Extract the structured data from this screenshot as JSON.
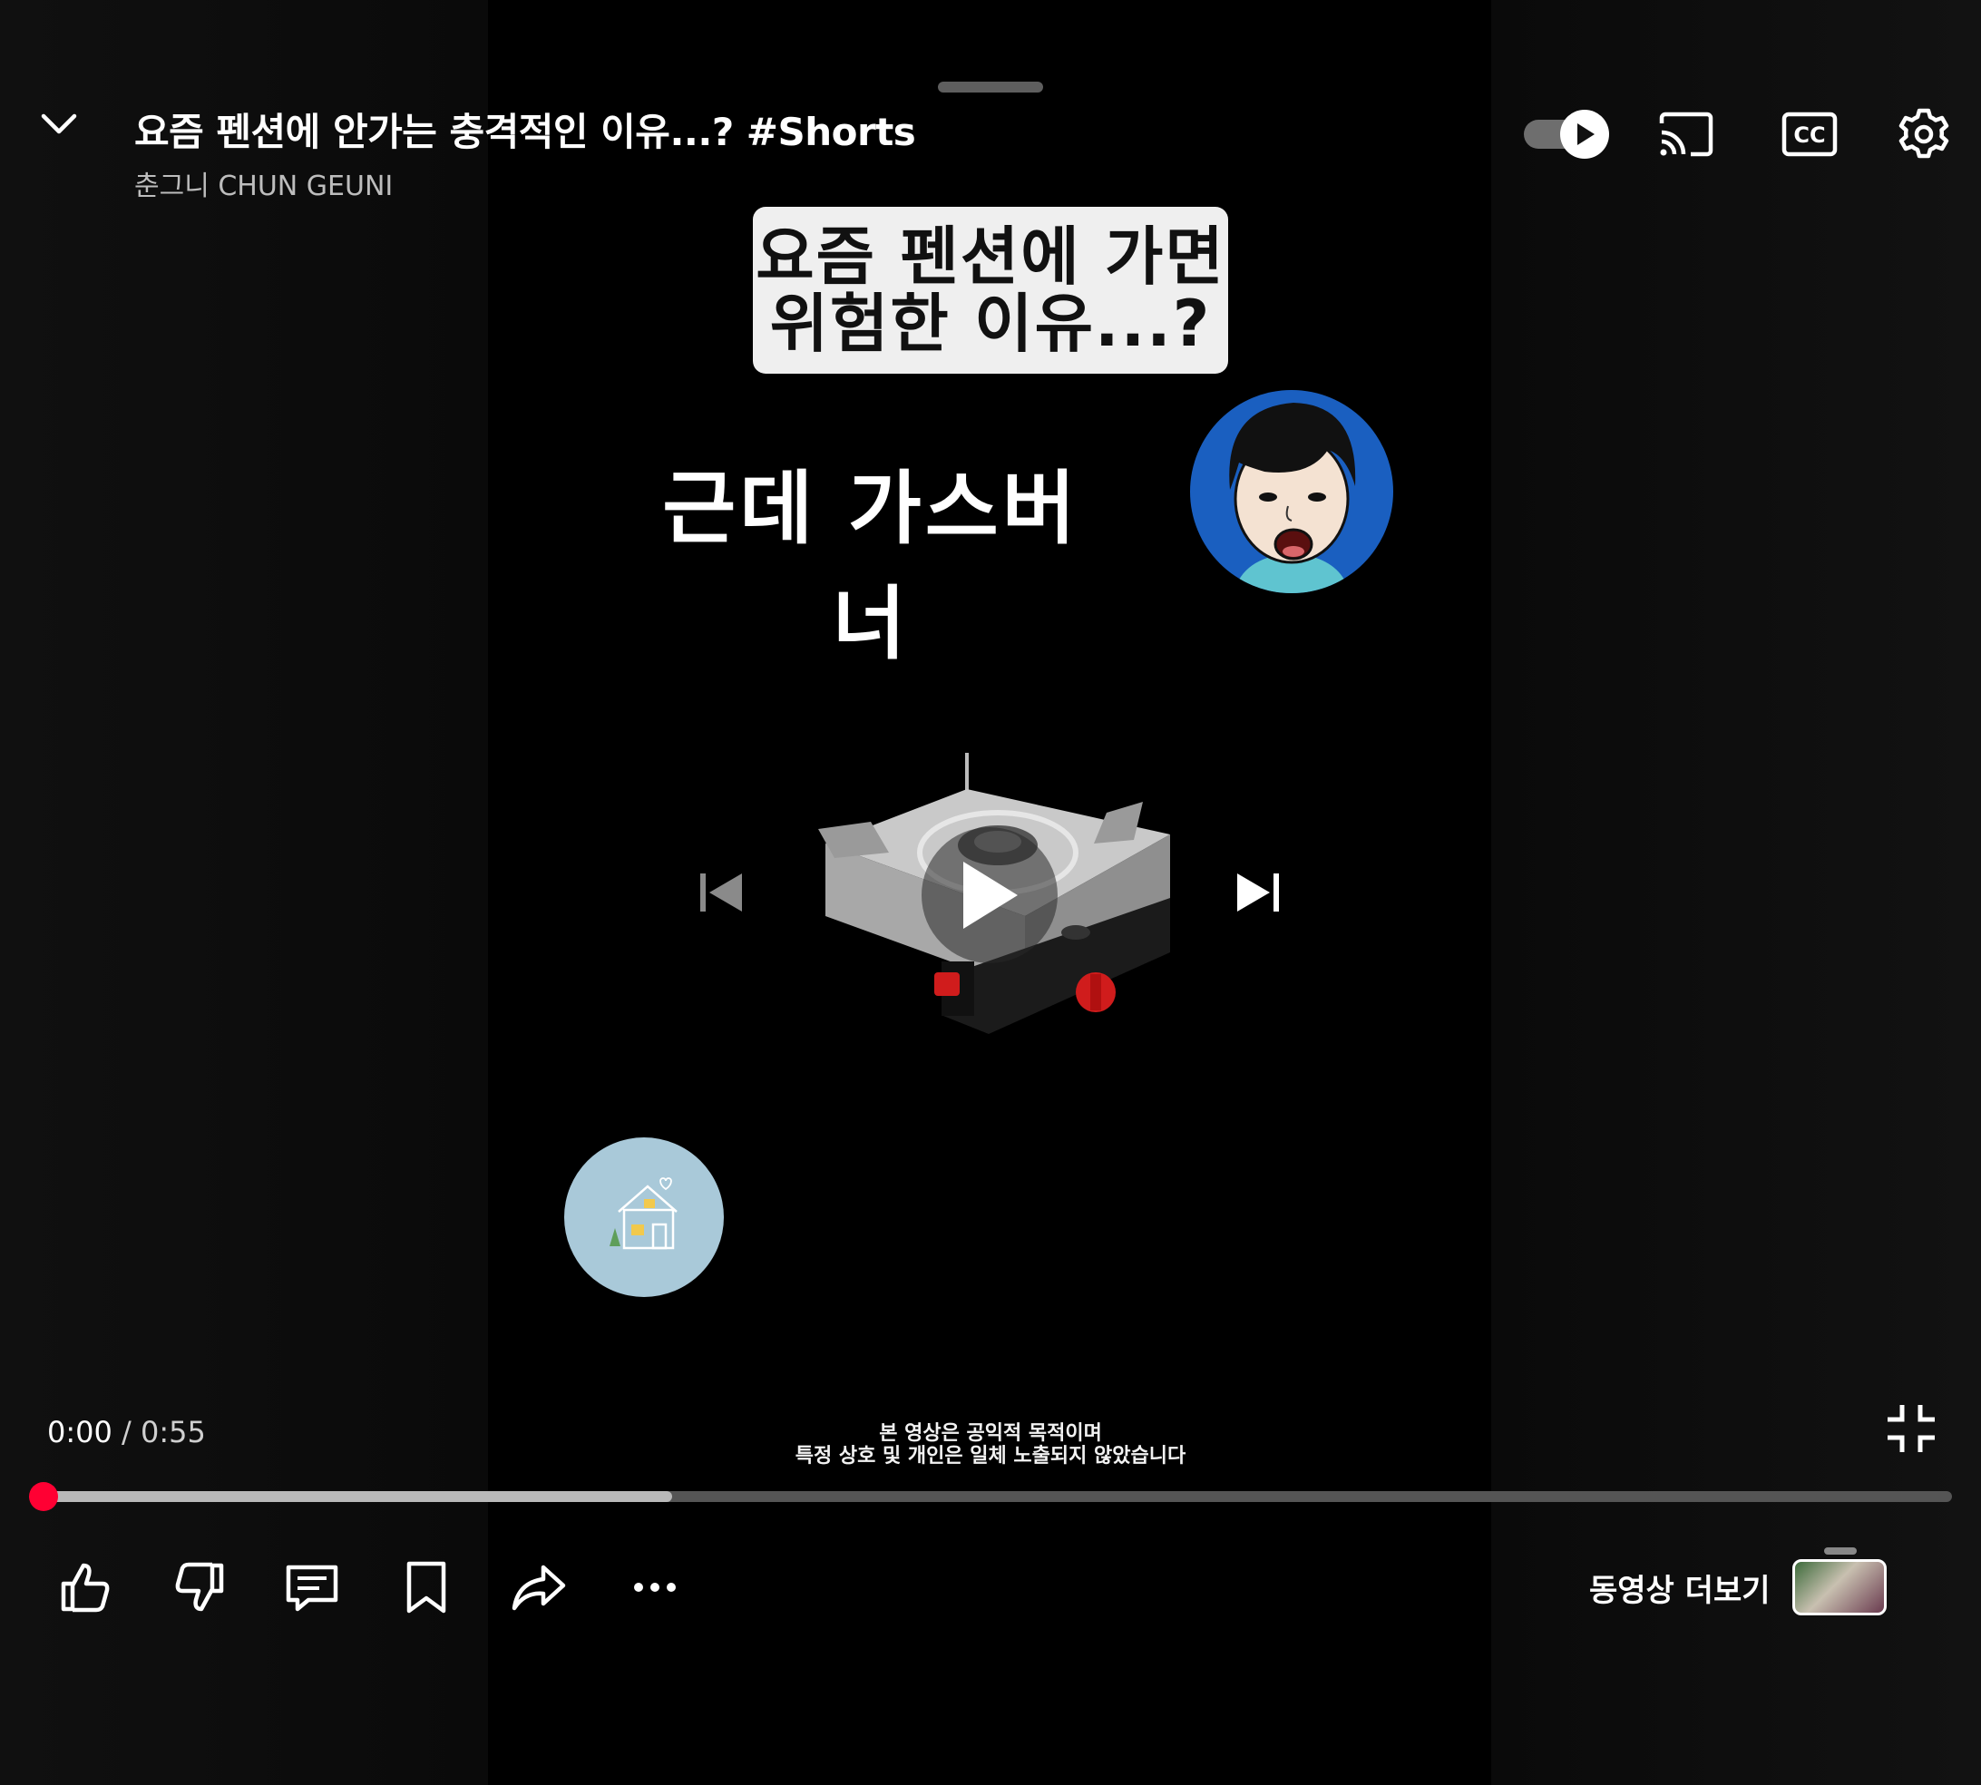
{
  "header": {
    "title": "요즘 펜션에 안가는 충격적인 이유...? #Shorts",
    "channel": "춘그니 CHUN GEUNI",
    "icons": [
      "chevron-down-icon",
      "autoplay-toggle",
      "cast-icon",
      "captions-icon",
      "settings-icon"
    ]
  },
  "video": {
    "caption_line1": "요즘 펜션에 가면",
    "caption_line2": "위험한 이유...?",
    "subtitle": "근데 가스버너",
    "disclaimer_line1": "본 영상은 공익적 목적이며",
    "disclaimer_line2": "특정 상호 및 개인은 일체 노출되지 않았습니다"
  },
  "player": {
    "current_time": "0:00",
    "separator": " / ",
    "duration": "0:55",
    "progress_played": 0.0,
    "progress_buffered": 0.33,
    "accent_color": "#ff0000"
  },
  "actions": {
    "icons": [
      "like-icon",
      "dislike-icon",
      "comments-icon",
      "save-icon",
      "share-icon",
      "more-icon"
    ],
    "more_videos_label": "동영상 더보기"
  }
}
